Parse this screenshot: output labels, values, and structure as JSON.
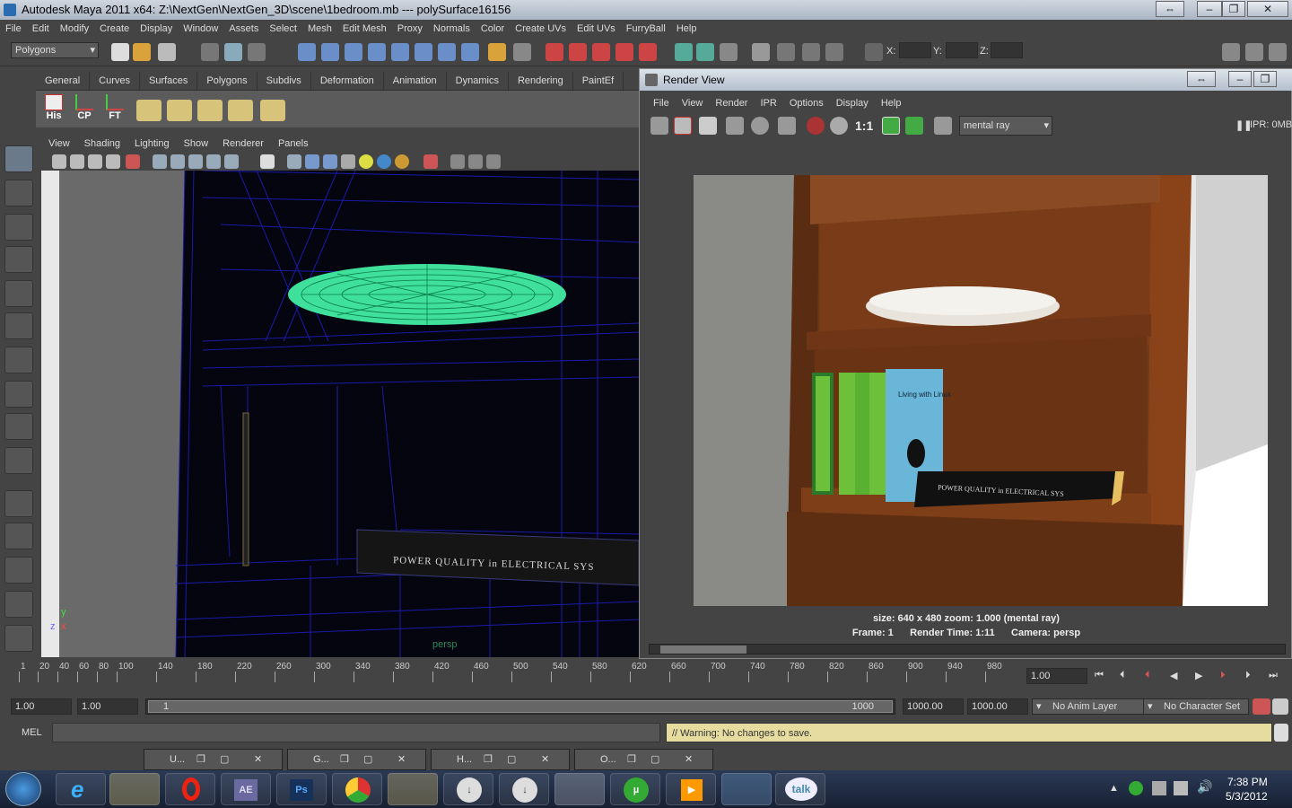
{
  "window": {
    "title": "Autodesk Maya 2011 x64: Z:\\NextGen\\NextGen_3D\\scene\\1bedroom.mb   ---   polySurface16156"
  },
  "menu": [
    "File",
    "Edit",
    "Modify",
    "Create",
    "Display",
    "Window",
    "Assets",
    "Select",
    "Mesh",
    "Edit Mesh",
    "Proxy",
    "Normals",
    "Color",
    "Create UVs",
    "Edit UVs",
    "FurryBall",
    "Help"
  ],
  "status": {
    "mode": "Polygons",
    "x_label": "X:",
    "y_label": "Y:",
    "z_label": "Z:"
  },
  "shelf": {
    "tabs": [
      "General",
      "Curves",
      "Surfaces",
      "Polygons",
      "Subdivs",
      "Deformation",
      "Animation",
      "Dynamics",
      "Rendering",
      "PaintEf"
    ],
    "buttons": [
      "His",
      "CP",
      "FT"
    ]
  },
  "panel": {
    "menu": [
      "View",
      "Shading",
      "Lighting",
      "Show",
      "Renderer",
      "Panels"
    ],
    "camera_label": "persp",
    "axis_y": "y",
    "axis_x": "x",
    "axis_z": "z",
    "book_text": "POWER QUALITY in ELECTRICAL SYS"
  },
  "render_view": {
    "title": "Render View",
    "menu": [
      "File",
      "View",
      "Render",
      "IPR",
      "Options",
      "Display",
      "Help"
    ],
    "ratio": "1:1",
    "renderer": "mental ray",
    "ipr": "IPR: 0MB",
    "book_text": "POWER QUALITY in ELECTRICAL SYS",
    "book2_text": "Living with Linux",
    "info_line1": "size: 640 x 480  zoom: 1.000        (mental ray)",
    "info_frame": "Frame: 1",
    "info_time": "Render Time: 1:11",
    "info_camera": "Camera: persp"
  },
  "timeline": {
    "ticks": [
      "1",
      "20",
      "40",
      "60",
      "80",
      "100",
      "140",
      "180",
      "220",
      "260",
      "300",
      "340",
      "380",
      "420",
      "460",
      "500",
      "540",
      "580",
      "620",
      "660",
      "700",
      "740",
      "780",
      "820",
      "860",
      "900",
      "940",
      "980"
    ],
    "current": "1.00"
  },
  "range": {
    "start": "1.00",
    "start2": "1.00",
    "slider_start": "1",
    "slider_end": "1000",
    "end": "1000.00",
    "end2": "1000.00",
    "anim_layer": "No Anim Layer",
    "char_set": "No Character Set"
  },
  "command": {
    "label": "MEL",
    "message": "// Warning: No changes to save."
  },
  "minimized": [
    "U...",
    "G...",
    "H...",
    "O..."
  ],
  "taskbar": {
    "time": "7:38 PM",
    "date": "5/3/2012",
    "ae_label": "AE",
    "ps_label": "Ps",
    "talk_label": "talk"
  }
}
